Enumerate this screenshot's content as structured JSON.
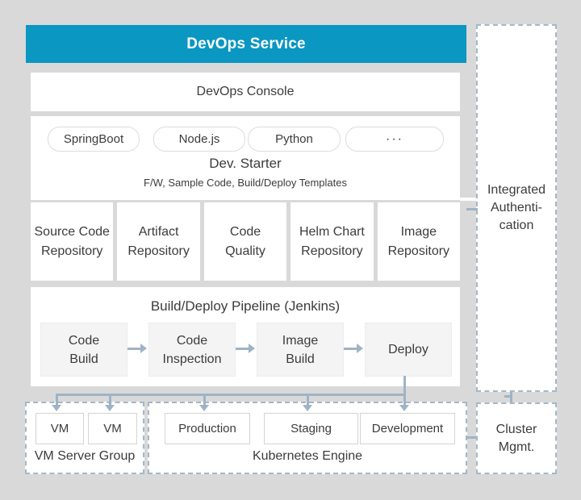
{
  "header": {
    "title": "DevOps Service"
  },
  "console": {
    "label": "DevOps Console"
  },
  "dev_starter": {
    "pills": [
      "SpringBoot",
      "Node.js",
      "Python",
      "···"
    ],
    "title": "Dev. Starter",
    "subtitle": "F/W, Sample Code, Build/Deploy Templates"
  },
  "repositories": [
    {
      "line1": "Source Code",
      "line2": "Repository"
    },
    {
      "line1": "Artifact",
      "line2": "Repository"
    },
    {
      "line1": "Code",
      "line2": "Quality"
    },
    {
      "line1": "Helm Chart",
      "line2": "Repository"
    },
    {
      "line1": "Image",
      "line2": "Repository"
    }
  ],
  "pipeline": {
    "title": "Build/Deploy Pipeline (Jenkins)",
    "steps": [
      {
        "line1": "Code",
        "line2": "Build"
      },
      {
        "line1": "Code",
        "line2": "Inspection"
      },
      {
        "line1": "Image",
        "line2": "Build"
      },
      {
        "line1": "Deploy",
        "line2": ""
      }
    ]
  },
  "vm_group": {
    "label": "VM Server Group",
    "vms": [
      "VM",
      "VM"
    ]
  },
  "kubernetes": {
    "label": "Kubernetes Engine",
    "environments": [
      "Production",
      "Staging",
      "Development"
    ]
  },
  "integrated_auth": {
    "line1": "Integrated",
    "line2": "Authenti-",
    "line3": "cation"
  },
  "cluster_mgmt": {
    "line1": "Cluster",
    "line2": "Mgmt."
  },
  "colors": {
    "background": "#d9d9d9",
    "header_bg": "#0a97c1",
    "header_text": "#ffffff",
    "connector": "#9fb3c5",
    "dashed_border": "#a4b8c8",
    "text_dark": "#3c3c3c",
    "step_bg": "#f4f4f4",
    "box_border": "#d4d4d4",
    "pill_border": "#dcdcdc",
    "box_bg": "#ffffff"
  }
}
